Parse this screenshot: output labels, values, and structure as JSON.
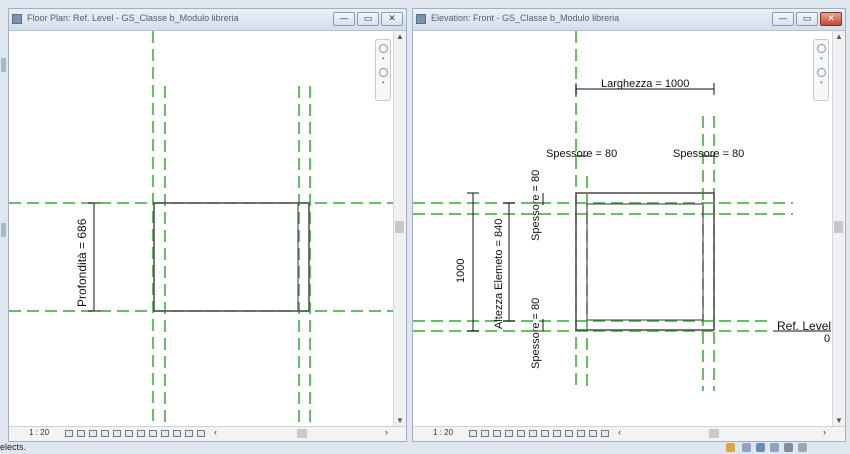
{
  "windows": {
    "floor_plan": {
      "title": "Floor Plan: Ref. Level - GS_Classe b_Modulo libreria",
      "scale": "1 : 20",
      "dimension_depth": "Profondità = 686"
    },
    "elevation": {
      "title": "Elevation: Front - GS_Classe b_Modulo libreria",
      "scale": "1 : 20",
      "dimension_width": "Larghezza = 1000",
      "dimension_thickness_left": "Spessore = 80",
      "dimension_thickness_right": "Spessore = 80",
      "dimension_thickness_side_top": "Spessore = 80",
      "dimension_thickness_side_bottom": "Spessore = 80",
      "dimension_height_element": "Altezza Elemeto = 840",
      "dimension_total_height": "1000",
      "level_name": "Ref. Level",
      "level_value": "0"
    }
  },
  "window_controls": {
    "minimize": "—",
    "restore": "▭",
    "close": "✕"
  },
  "status": {
    "text": "elects."
  },
  "colors": {
    "reference_plane": "#33aa33",
    "geometry": "#555555",
    "dimension": "#111111",
    "close_button": "#c14a32"
  }
}
